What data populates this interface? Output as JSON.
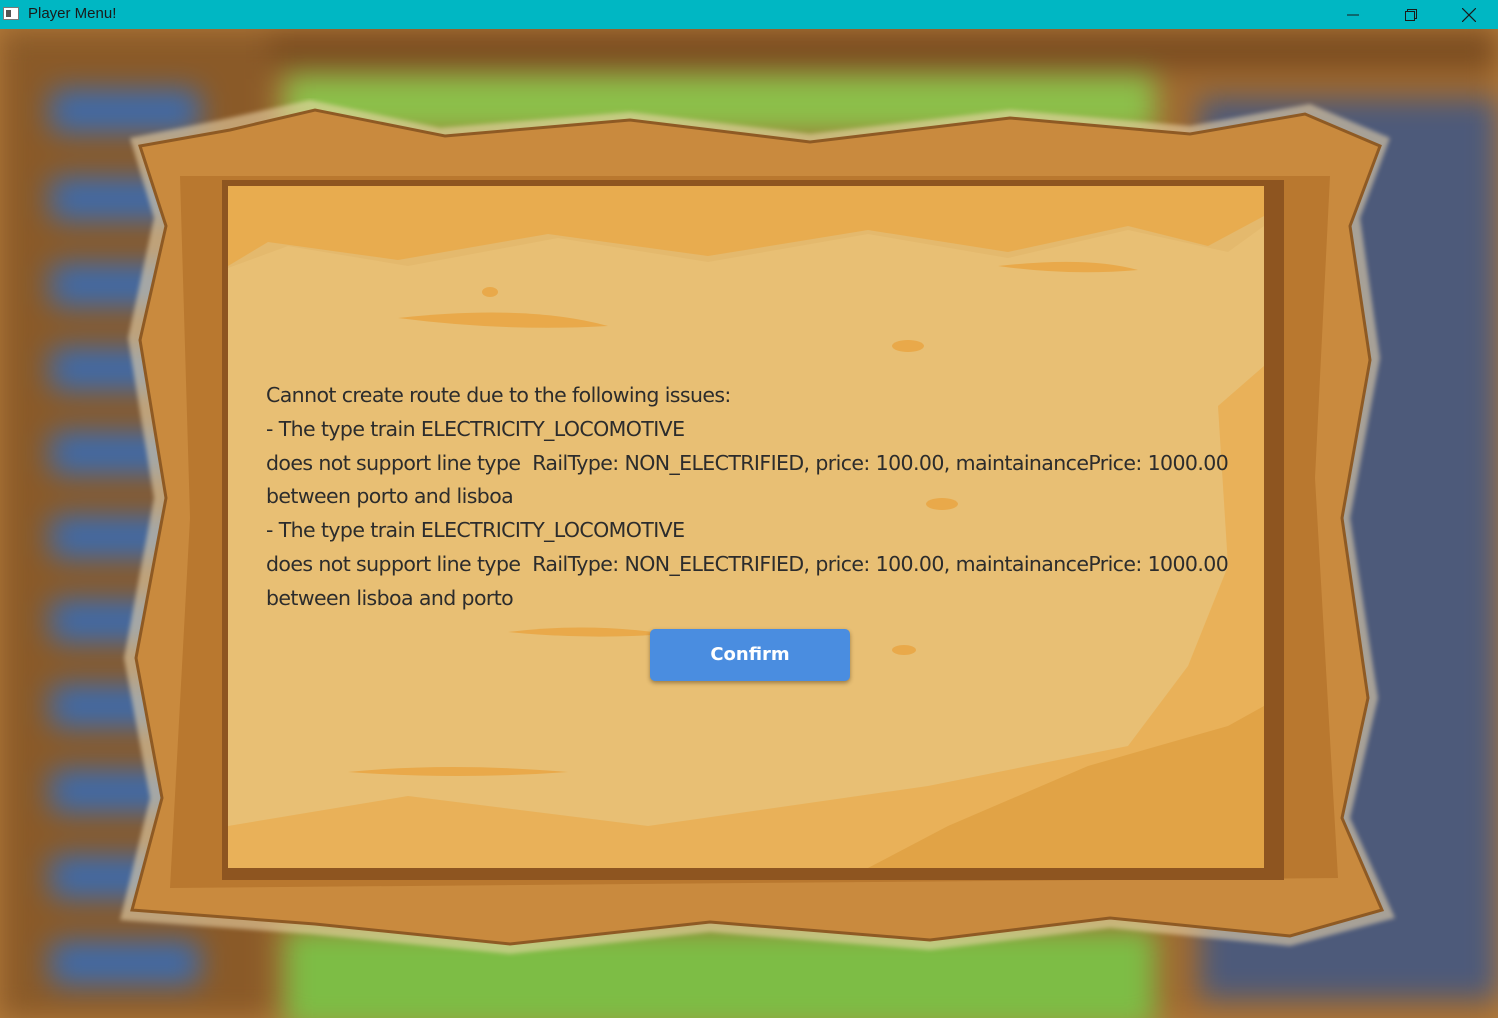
{
  "window": {
    "title": "Player Menu!",
    "titlebar_color": "#00b7c3",
    "controls": {
      "minimize_icon": "minimize-icon",
      "maximize_icon": "restore-icon",
      "close_icon": "close-icon"
    }
  },
  "dialog": {
    "message_lines": [
      "Cannot create route due to the following issues:",
      "- The type train ELECTRICITY_LOCOMOTIVE",
      "does not support line type  RailType: NON_ELECTRIFIED, price: 100.00, maintainancePrice: 1000.00",
      "between porto and lisboa",
      "- The type train ELECTRICITY_LOCOMOTIVE",
      "does not support line type  RailType: NON_ELECTRIFIED, price: 100.00, maintainancePrice: 1000.00",
      "between lisboa and porto"
    ],
    "confirm_label": "Confirm",
    "confirm_color": "#4a8de0",
    "parchment_color": "#e4b96d",
    "frame_color": "#c98a3e"
  }
}
